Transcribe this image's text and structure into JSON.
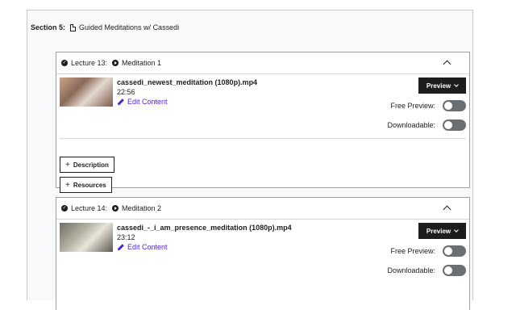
{
  "section": {
    "label": "Section 5:",
    "title": "Guided Meditations w/ Cassedi",
    "icon": "doc-icon"
  },
  "lectures": [
    {
      "label": "Lecture 13:",
      "title": "Meditation 1",
      "file_name": "cassedi_newest_meditation (1080p).mp4",
      "duration": "22:56",
      "edit_label": "Edit Content",
      "preview_label": "Preview",
      "free_preview_label": "Free Preview:",
      "downloadable_label": "Downloadable:",
      "free_preview_on": false,
      "downloadable_on": false,
      "description_label": "Description",
      "resources_label": "Resources"
    },
    {
      "label": "Lecture 14:",
      "title": "Meditation 2",
      "file_name": "cassedi_-_i_am_presence_meditation (1080p).mp4",
      "duration": "23:12",
      "edit_label": "Edit Content",
      "preview_label": "Preview",
      "free_preview_label": "Free Preview:",
      "downloadable_label": "Downloadable:",
      "free_preview_on": false,
      "downloadable_on": false
    }
  ],
  "colors": {
    "accent_purple": "#5624d0",
    "dark": "#1c1d1f",
    "toggle_off": "#6a6f73"
  }
}
